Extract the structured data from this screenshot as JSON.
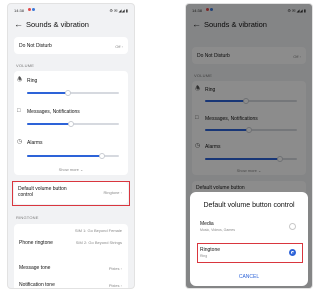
{
  "status_bar": {
    "time": "14:38",
    "icons_text": "⚙ ✉ ◢◢ ▮",
    "dot_colors": [
      "#e24b4b",
      "#3c78d8"
    ]
  },
  "header": {
    "back_icon": "arrow-left-icon",
    "title": "Sounds & vibration"
  },
  "dnd": {
    "label": "Do Not Disturb",
    "value": "Off"
  },
  "volume": {
    "section_label": "VOLUME",
    "items": [
      {
        "label": "Ring",
        "icon": "bell-icon",
        "level": 0.45
      },
      {
        "label": "Messages, Notifications",
        "icon": "message-icon",
        "level": 0.48
      },
      {
        "label": "Alarms",
        "icon": "clock-icon",
        "level": 0.82
      }
    ],
    "show_more": "Show more"
  },
  "default_volume_button": {
    "label": "Default volume button control",
    "value": "Ringtone"
  },
  "ringtone_section": {
    "label": "RINGTONE",
    "phone_ringtone_label": "Phone ringtone",
    "sim1": "SIM 1: Go Beyond Female",
    "sim2": "SIM 2: Go Beyond Strings",
    "message_tone_label": "Message tone",
    "message_tone_value": "Pixies",
    "notification_tone_label": "Notification tone",
    "notification_tone_value": "Pixies"
  },
  "dialog": {
    "title": "Default volume button control",
    "options": [
      {
        "label": "Media",
        "sub": "Music, Videos, Games",
        "selected": false
      },
      {
        "label": "Ringtone",
        "sub": "Ring",
        "selected": true
      }
    ],
    "cancel": "CANCEL"
  },
  "highlight_color": "#d9363e",
  "accent_color": "#2d63d8"
}
